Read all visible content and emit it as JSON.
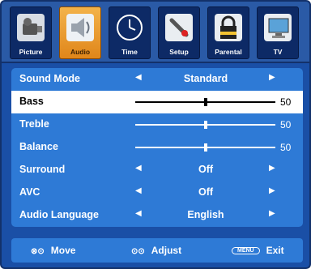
{
  "tabs": [
    {
      "label": "Picture",
      "icon": "camcorder-icon"
    },
    {
      "label": "Audio",
      "icon": "speaker-icon"
    },
    {
      "label": "Time",
      "icon": "clock-icon"
    },
    {
      "label": "Setup",
      "icon": "wrench-icon"
    },
    {
      "label": "Parental",
      "icon": "lock-icon"
    },
    {
      "label": "TV",
      "icon": "monitor-icon"
    }
  ],
  "menu": {
    "sound_mode": {
      "label": "Sound Mode",
      "value": "Standard"
    },
    "bass": {
      "label": "Bass",
      "value": "50",
      "level": 0.5
    },
    "treble": {
      "label": "Treble",
      "value": "50",
      "level": 0.5
    },
    "balance": {
      "label": "Balance",
      "value": "50",
      "level": 0.5
    },
    "surround": {
      "label": "Surround",
      "value": "Off"
    },
    "avc": {
      "label": "AVC",
      "value": "Off"
    },
    "audio_language": {
      "label": "Audio Language",
      "value": "English"
    }
  },
  "footer": {
    "move_icon": "⊗⊙",
    "move_label": "Move",
    "adjust_icon": "⊙⊙",
    "adjust_label": "Adjust",
    "menu_key": "MENU",
    "exit_label": "Exit"
  },
  "colors": {
    "active_tab": "#f0a030",
    "panel": "#2e7ad6",
    "tabbar": "#2a5aa6"
  }
}
